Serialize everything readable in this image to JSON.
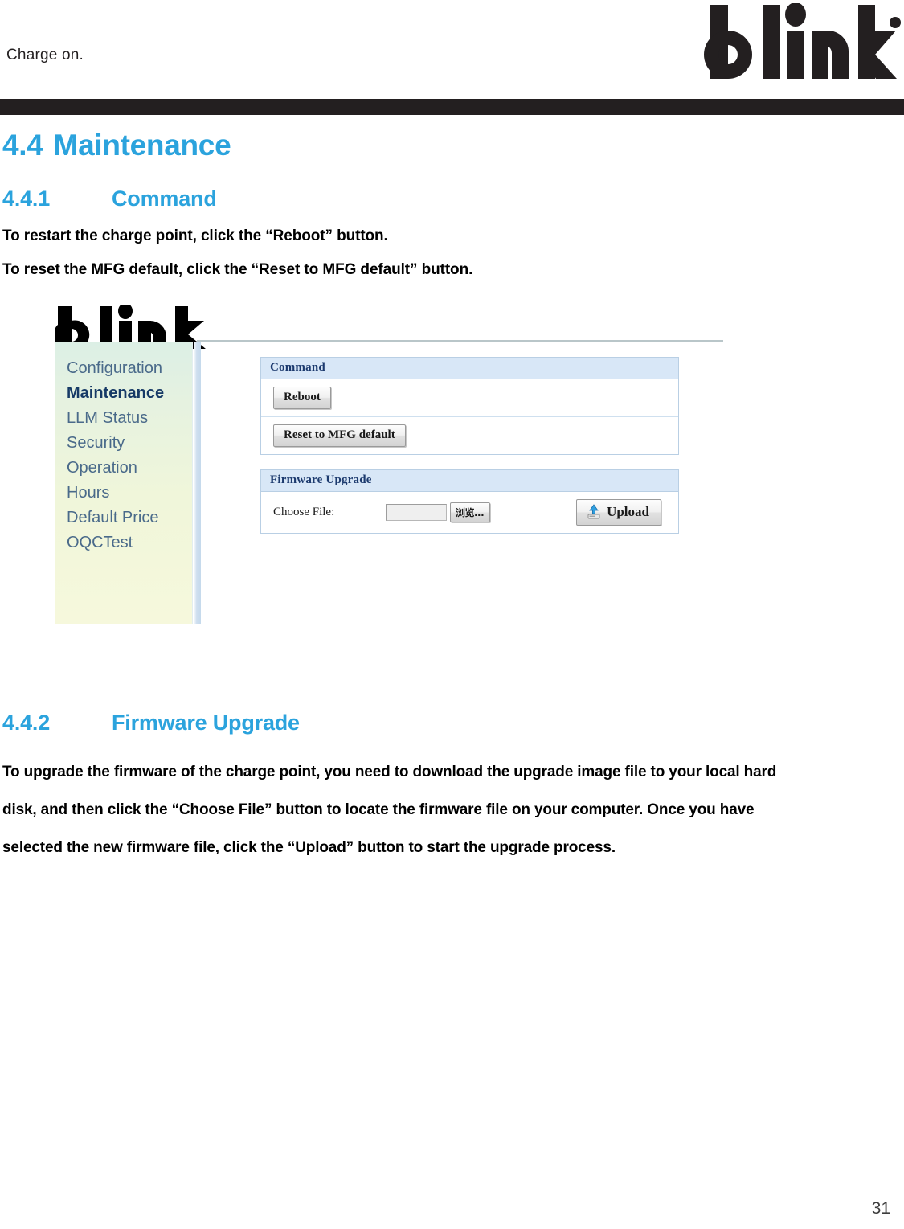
{
  "header": {
    "tagline": "Charge on.",
    "brand": "blink"
  },
  "document": {
    "section": {
      "number": "4.4",
      "title": "Maintenance"
    },
    "subsection_1": {
      "number": "4.4.1",
      "title": "Command",
      "paragraphs": [
        "To restart the charge point, click the “Reboot” button.",
        "To reset the MFG default, click the “Reset to MFG default” button."
      ]
    },
    "subsection_2": {
      "number": "4.4.2",
      "title": "Firmware Upgrade",
      "paragraph": "To upgrade the firmware of the charge point, you need to download the upgrade image file to your local hard disk, and then click the “Choose File” button to locate the firmware file on your computer. Once you have selected the new firmware file, click the “Upload” button to start the upgrade process."
    },
    "page_number": "31"
  },
  "embedded_ui": {
    "logo": "blink",
    "sidebar": {
      "items": [
        {
          "label": "Configuration",
          "active": false
        },
        {
          "label": "Maintenance",
          "active": true
        },
        {
          "label": "LLM Status",
          "active": false
        },
        {
          "label": "Security",
          "active": false
        },
        {
          "label": "Operation\nHours",
          "active": false
        },
        {
          "label": "Default Price",
          "active": false
        },
        {
          "label": "OQCTest",
          "active": false
        }
      ]
    },
    "command_panel": {
      "title": "Command",
      "reboot_button": "Reboot",
      "reset_button": "Reset to MFG default"
    },
    "firmware_panel": {
      "title": "Firmware Upgrade",
      "choose_file_label": "Choose File:",
      "file_input_value": "",
      "browse_button": "浏览...",
      "upload_button": "Upload"
    },
    "colors": {
      "panel_header_bg": "#d8e7f7",
      "panel_header_text": "#1c3a6e",
      "panel_border": "#b9cfe4",
      "sidebar_top": "#dcefe5",
      "sidebar_bottom": "#f6f8dc",
      "nav_text": "#4a6a8a",
      "nav_active_text": "#163a66"
    }
  },
  "theme": {
    "accent_blue": "#2ba3dd",
    "rule_black": "#231f20",
    "body_text": "#000000"
  }
}
